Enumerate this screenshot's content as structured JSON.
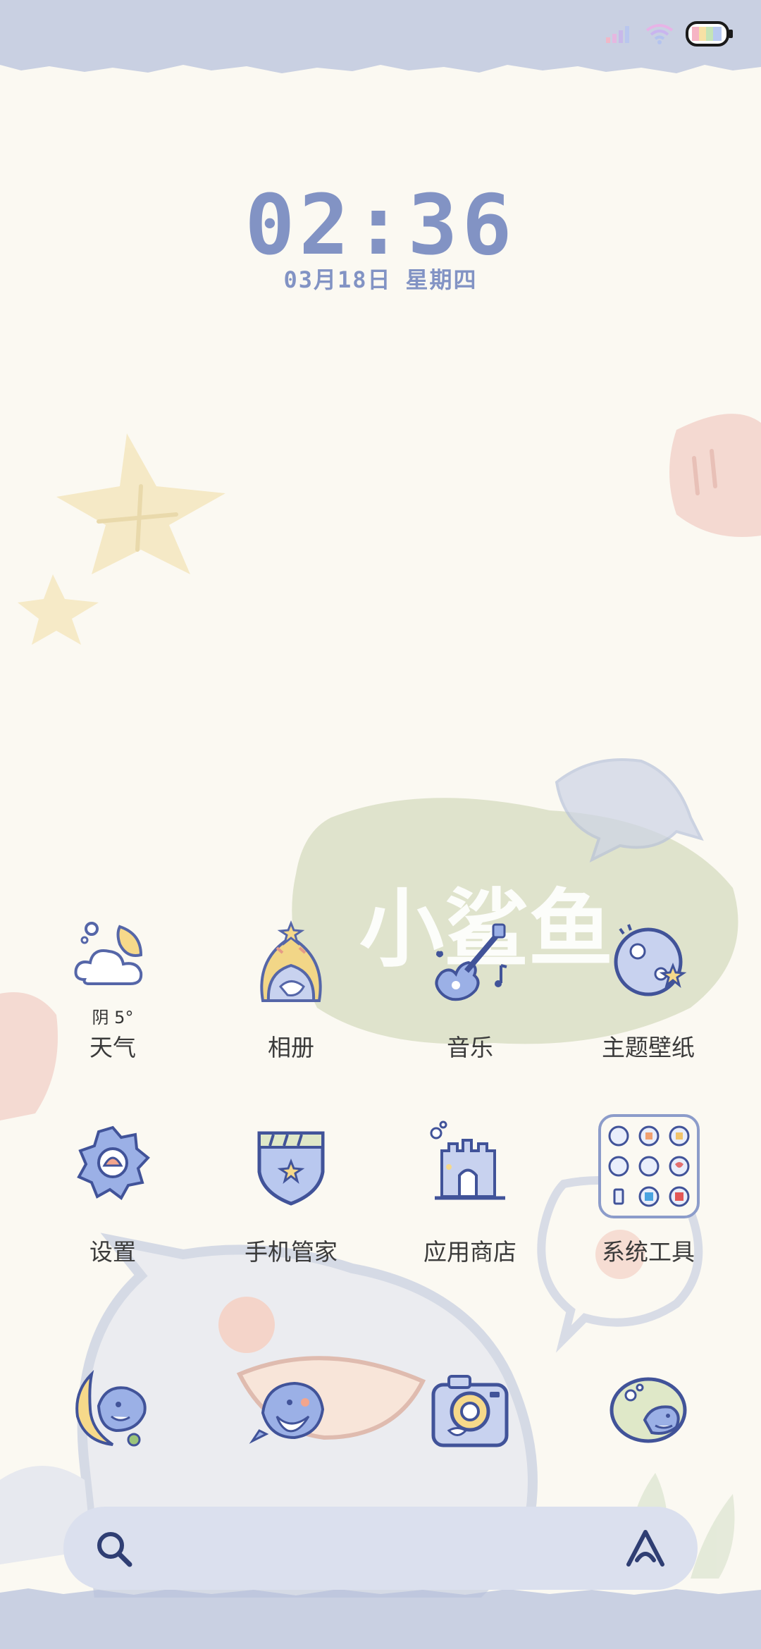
{
  "status_bar": {
    "signal_icon": "signal-bars-icon",
    "wifi_icon": "wifi-icon",
    "battery_icon": "battery-icon"
  },
  "clock": {
    "time": "02:36",
    "date_month": "03月18日",
    "date_weekday": "星期四"
  },
  "apps_row1": [
    {
      "name": "weather",
      "label": "天气",
      "sub": "阴 5°",
      "icon": "cloud-moon-icon"
    },
    {
      "name": "gallery",
      "label": "相册",
      "icon": "shark-hood-icon"
    },
    {
      "name": "music",
      "label": "音乐",
      "icon": "guitar-icon"
    },
    {
      "name": "themes",
      "label": "主题壁纸",
      "icon": "planet-icon"
    }
  ],
  "apps_row2": [
    {
      "name": "settings",
      "label": "设置",
      "icon": "gear-icon"
    },
    {
      "name": "security",
      "label": "手机管家",
      "icon": "shield-icon"
    },
    {
      "name": "app-store",
      "label": "应用商店",
      "icon": "castle-icon"
    },
    {
      "name": "system-tools",
      "label": "系统工具",
      "icon": "folder-icon"
    }
  ],
  "dock": [
    {
      "name": "phone",
      "icon": "shark-moon-icon"
    },
    {
      "name": "messages",
      "icon": "shark-bubble-icon"
    },
    {
      "name": "camera",
      "icon": "camera-icon"
    },
    {
      "name": "browser",
      "icon": "shark-sphere-icon"
    }
  ],
  "wallpaper_text": "小鲨鱼",
  "search": {
    "search_icon": "search-icon",
    "assistant_icon": "assistant-icon"
  },
  "colors": {
    "accent": "#8293c4",
    "background": "#fbf9f2",
    "statusbar": "#c9d0e2",
    "searchbar": "#dbe0ee"
  }
}
